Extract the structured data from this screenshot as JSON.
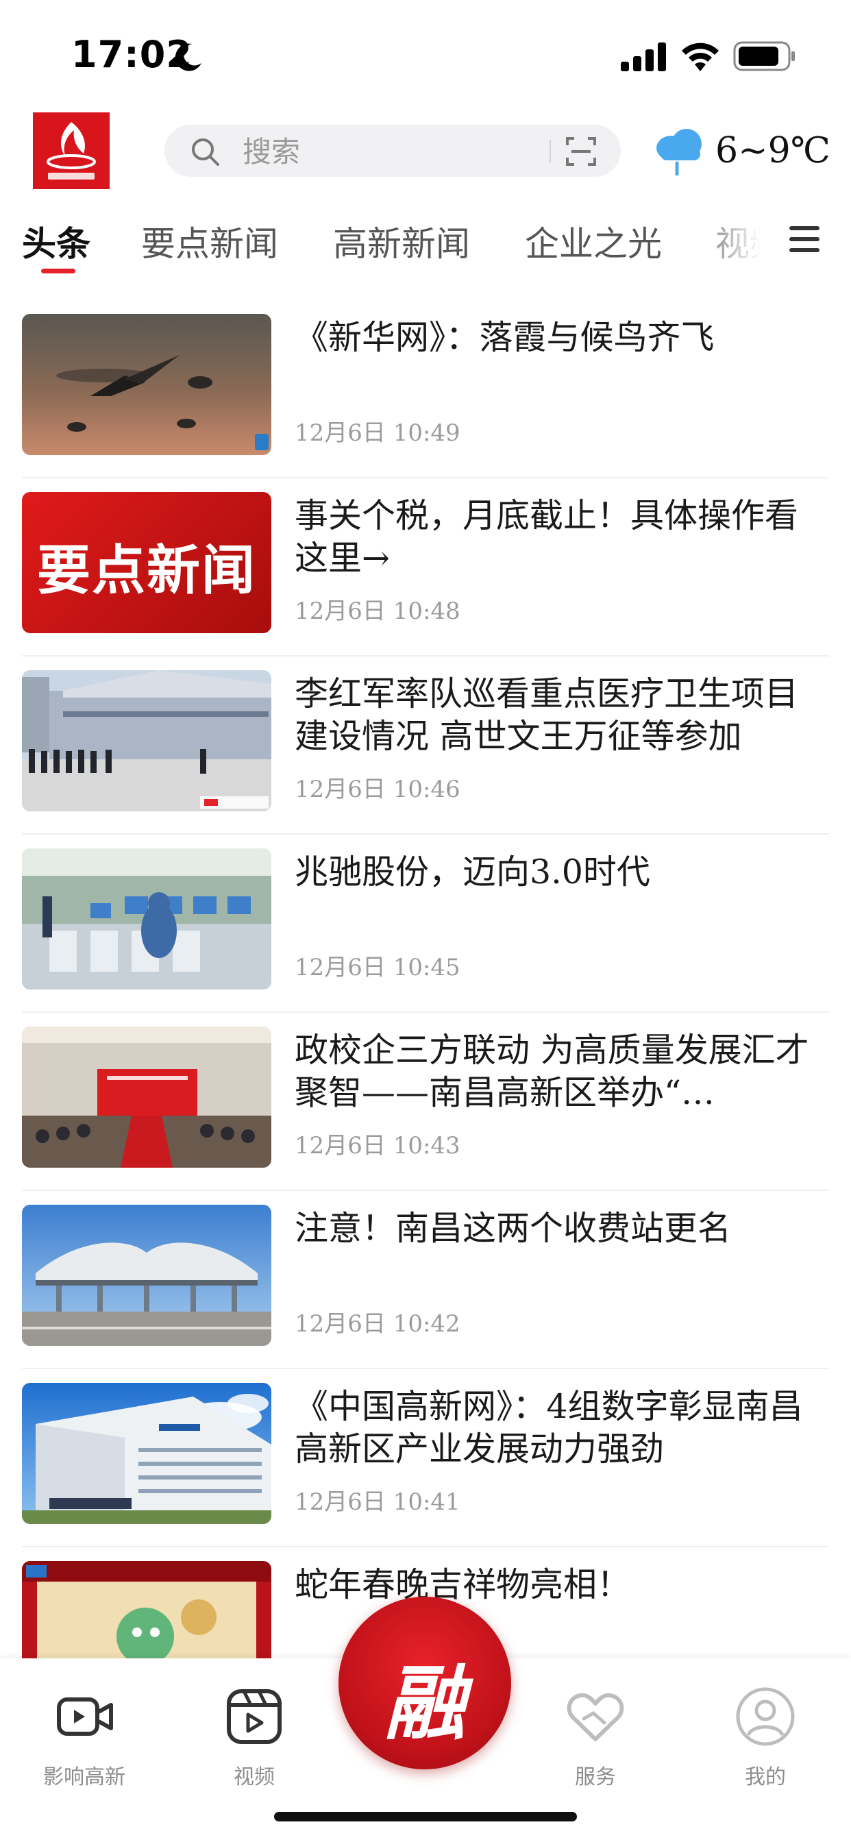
{
  "status_bar": {
    "time": "17:02"
  },
  "header": {
    "search_placeholder": "搜索",
    "weather": {
      "temperature": "6~9℃",
      "icon": "cloud-rain-icon"
    }
  },
  "tabs": [
    {
      "label": "头条",
      "active": true
    },
    {
      "label": "要点新闻",
      "active": false
    },
    {
      "label": "高新新闻",
      "active": false
    },
    {
      "label": "企业之光",
      "active": false
    },
    {
      "label": "视频",
      "active": false
    }
  ],
  "news": [
    {
      "title": "《新华网》：落霞与候鸟齐飞",
      "time": "12月6日  10:49",
      "thumb": "birds-sunset"
    },
    {
      "title": "事关个税，月底截止！具体操作看这里→",
      "time": "12月6日  10:48",
      "thumb": "news-banner",
      "thumb_text": "要点新闻"
    },
    {
      "title": "李红军率队巡看重点医疗卫生项目建设情况  高世文王万征等参加",
      "time": "12月6日  10:46",
      "thumb": "construction-site"
    },
    {
      "title": "兆驰股份，迈向3.0时代",
      "time": "12月6日  10:45",
      "thumb": "factory-line"
    },
    {
      "title": "政校企三方联动  为高质量发展汇才聚智——南昌高新区举办“…",
      "time": "12月6日  10:43",
      "thumb": "meeting-room"
    },
    {
      "title": "注意！南昌这两个收费站更名",
      "time": "12月6日  10:42",
      "thumb": "toll-station"
    },
    {
      "title": "《中国高新网》：4组数字彰显南昌高新区产业发展动力强劲",
      "time": "12月6日  10:41",
      "thumb": "office-building"
    },
    {
      "title": "蛇年春晚吉祥物亮相！",
      "time": "",
      "thumb": "snake-mascot"
    }
  ],
  "bottom_nav": {
    "items": [
      {
        "label": "影响高新",
        "icon": "video-camera-icon"
      },
      {
        "label": "视频",
        "icon": "play-square-icon"
      },
      {
        "label": "服务",
        "icon": "heart-hands-icon"
      },
      {
        "label": "我的",
        "icon": "user-circle-icon"
      }
    ],
    "center_label": "融"
  },
  "colors": {
    "accent": "#e3222b",
    "brand_red": "#d8141c",
    "text_primary": "#1a1a1a",
    "text_secondary": "#9b9b9b"
  }
}
